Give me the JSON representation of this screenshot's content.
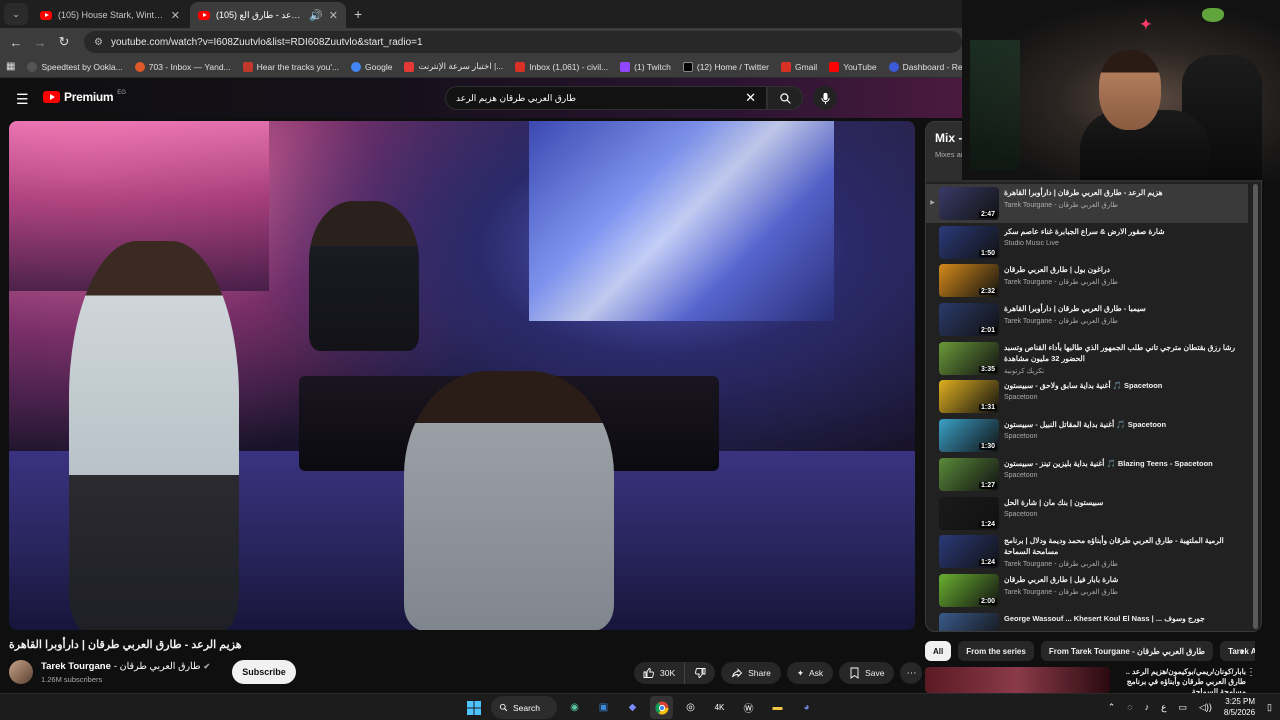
{
  "browser": {
    "tabs": [
      {
        "title": "(105) House Stark, Winterfell Th",
        "active": false
      },
      {
        "title": "(105) هزيم الرعد - طارق الع",
        "active": true
      }
    ],
    "new_tab_label": "+",
    "url": "youtube.com/watch?v=I608Zuutvlo&list=RDI608Zuutvlo&start_radio=1",
    "bookmarks": [
      {
        "label": "Speedtest by Ookla...",
        "color": "#222222"
      },
      {
        "label": "703 - Inbox — Yand...",
        "color": "#e0592a"
      },
      {
        "label": "Hear the tracks you'...",
        "color": "#c0392b"
      },
      {
        "label": "Google",
        "color": "#4285f4"
      },
      {
        "label": "اختبار سرعة الإنترنت |...",
        "color": "#e53935"
      },
      {
        "label": "Inbox (1,061) - civil...",
        "color": "#d93025"
      },
      {
        "label": "(1) Twitch",
        "color": "#9146ff"
      },
      {
        "label": "(12) Home / Twitter",
        "color": "#000000"
      },
      {
        "label": "Gmail",
        "color": "#d93025"
      },
      {
        "label": "YouTube",
        "color": "#ff0000"
      },
      {
        "label": "Dashboard - Restre...",
        "color": "#3b5bdb"
      }
    ]
  },
  "youtube": {
    "logo_text": "Premium",
    "region": "EG",
    "search_query": "طارق العربي طرقان هزيم الرعد"
  },
  "video": {
    "title": "هزيم الرعد - طارق العربي طرقان | دارأوبرا القاهرة",
    "channel_name": "Tarek Tourgane",
    "channel_alt": "- طارق العربي طرقان",
    "subscribers": "1.26M subscribers",
    "subscribe_label": "Subscribe",
    "likes": "30K",
    "share_label": "Share",
    "ask_label": "Ask",
    "save_label": "Save"
  },
  "playlist": {
    "title": "Mix -",
    "subtitle": "Mixes ar",
    "items": [
      {
        "title": "هزيم الرعد - طارق العربي طرقان | دارأوبرا القاهرة",
        "channel": "Tarek Tourgane - طارق العربي طرقان",
        "duration": "2:47",
        "active": true,
        "thumb": "#3a3a6a"
      },
      {
        "title": "شارة صقور الارض & سراع الجبابرة غناء عاصم سكر",
        "channel": "Studio Music Live",
        "duration": "1:50",
        "active": false,
        "thumb": "#2a3a7a"
      },
      {
        "title": "دراغون بول | طارق العربي طرقان",
        "channel": "Tarek Tourgane - طارق العربي طرقان",
        "duration": "2:32",
        "active": false,
        "thumb": "#d68a1a"
      },
      {
        "title": "سيمبا - طارق العربي طرقان | دارأوبرا القاهرة",
        "channel": "Tarek Tourgane - طارق العربي طرقان",
        "duration": "2:01",
        "active": false,
        "thumb": "#2a3a6a"
      },
      {
        "title": "رشا رزق بقتطان مترجي تاني طلب الجمهور الذي طالبها بأداء القناص وتسبد الحضور 32 مليون مشاهدة",
        "channel": "تكريك كرتونية",
        "duration": "3:35",
        "active": false,
        "thumb": "#6a9a3a"
      },
      {
        "title": "أغنية بداية سابق ولاحق - سبيستون 🎵 Spacetoon",
        "channel": "Spacetoon",
        "duration": "1:31",
        "active": false,
        "thumb": "#e0b020"
      },
      {
        "title": "أغنية بداية المقاتل النبيل - سبيستون 🎵 Spacetoon",
        "channel": "Spacetoon",
        "duration": "1:30",
        "active": false,
        "thumb": "#3aa0c8"
      },
      {
        "title": "أغنية بداية بليزين تينز - سبيستون 🎵 Blazing Teens - Spacetoon",
        "channel": "Spacetoon",
        "duration": "1:27",
        "active": false,
        "thumb": "#5a8a3a"
      },
      {
        "title": "سبيستون | بنك مان | شارة الحل",
        "channel": "Spacetoon",
        "duration": "1:24",
        "active": false,
        "thumb": "#1a1a1a"
      },
      {
        "title": "الرمية الملتهبة - طارق العربي طرقان وأبناؤه محمد وديمة ودلال | برنامج مسامحة السماحة",
        "channel": "Tarek Tourgane - طارق العربي طرقان",
        "duration": "1:24",
        "active": false,
        "thumb": "#2a3a7a"
      },
      {
        "title": "شارة بابار فيل | طارق العربي طرقان",
        "channel": "Tarek Tourgane - طارق العربي طرقان",
        "duration": "2:00",
        "active": false,
        "thumb": "#6ab030"
      },
      {
        "title": "George Wassouf ... Khesert Koul El Nass | ... جورج وسوف",
        "channel": "",
        "duration": "",
        "active": false,
        "thumb": "#3a5a8a"
      }
    ]
  },
  "chips": [
    "All",
    "From the series",
    "From Tarek Tourgane - طارق العربي طرقان",
    "Tarek A"
  ],
  "recommendation": {
    "title": "بابار/كونان/ريمي/بوكيمون/هزيم الرعد .. طارق العربي طرقان وأبناؤه في برنامج مسامحة السماحة"
  },
  "taskbar": {
    "search_label": "Search",
    "lang": "ع",
    "time": "3:25 PM",
    "date": "8/5/2026"
  }
}
